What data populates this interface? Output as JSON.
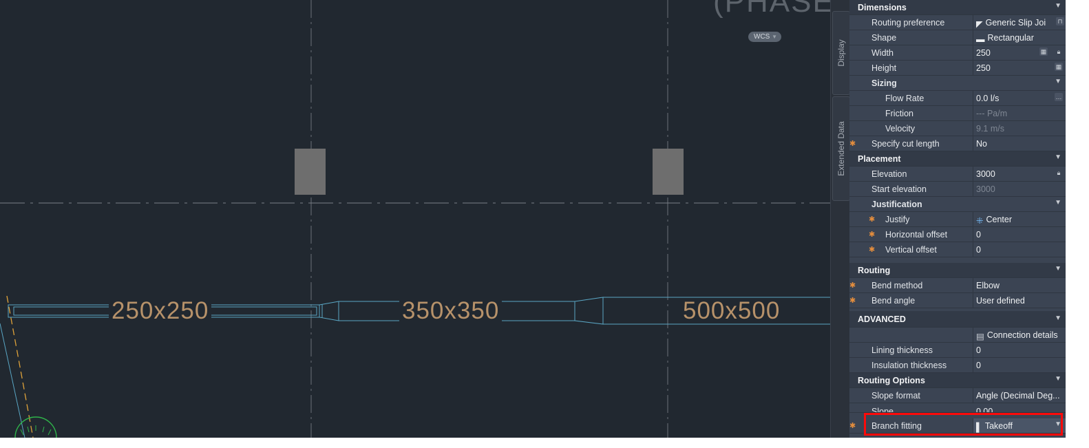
{
  "drawing": {
    "title_fragment": "(PHASE",
    "wcs_label": "WCS",
    "duct_labels": [
      "250x250",
      "350x350",
      "500x500"
    ]
  },
  "side_tabs": [
    "Display",
    "Extended Data"
  ],
  "properties": {
    "dimensions": {
      "header": "Dimensions",
      "routing_preference": {
        "label": "Routing preference",
        "value": "Generic Slip Joi"
      },
      "shape": {
        "label": "Shape",
        "value": "Rectangular"
      },
      "width": {
        "label": "Width",
        "value": "250"
      },
      "height": {
        "label": "Height",
        "value": "250"
      },
      "sizing": {
        "header": "Sizing",
        "flow_rate": {
          "label": "Flow Rate",
          "value": "0.0 l/s"
        },
        "friction": {
          "label": "Friction",
          "value": "--- Pa/m"
        },
        "velocity": {
          "label": "Velocity",
          "value": "9.1 m/s"
        }
      },
      "specify_cut_length": {
        "label": "Specify cut length",
        "value": "No"
      }
    },
    "placement": {
      "header": "Placement",
      "elevation": {
        "label": "Elevation",
        "value": "3000"
      },
      "start_elevation": {
        "label": "Start elevation",
        "value": "3000"
      },
      "justification": {
        "header": "Justification",
        "justify": {
          "label": "Justify",
          "value": "Center"
        },
        "horizontal_offset": {
          "label": "Horizontal offset",
          "value": "0"
        },
        "vertical_offset": {
          "label": "Vertical offset",
          "value": "0"
        }
      }
    },
    "routing": {
      "header": "Routing",
      "bend_method": {
        "label": "Bend method",
        "value": "Elbow"
      },
      "bend_angle": {
        "label": "Bend angle",
        "value": "User defined"
      }
    },
    "advanced": {
      "header": "ADVANCED",
      "connection_details": "Connection details",
      "lining_thickness": {
        "label": "Lining thickness",
        "value": "0"
      },
      "insulation_thickness": {
        "label": "Insulation thickness",
        "value": "0"
      }
    },
    "routing_options": {
      "header": "Routing Options",
      "slope_format": {
        "label": "Slope format",
        "value": "Angle (Decimal Deg..."
      },
      "slope": {
        "label": "Slope",
        "value": "0.00"
      },
      "branch_fitting": {
        "label": "Branch fitting",
        "value": "Takeoff"
      }
    }
  },
  "colors": {
    "canvas_bg": "#212830",
    "panel_bg": "#3b4453",
    "duct_outline": "#5aa6c4",
    "duct_label": "#b7926a",
    "highlight": "#ff0a0a",
    "required_star": "#e58e3d"
  }
}
